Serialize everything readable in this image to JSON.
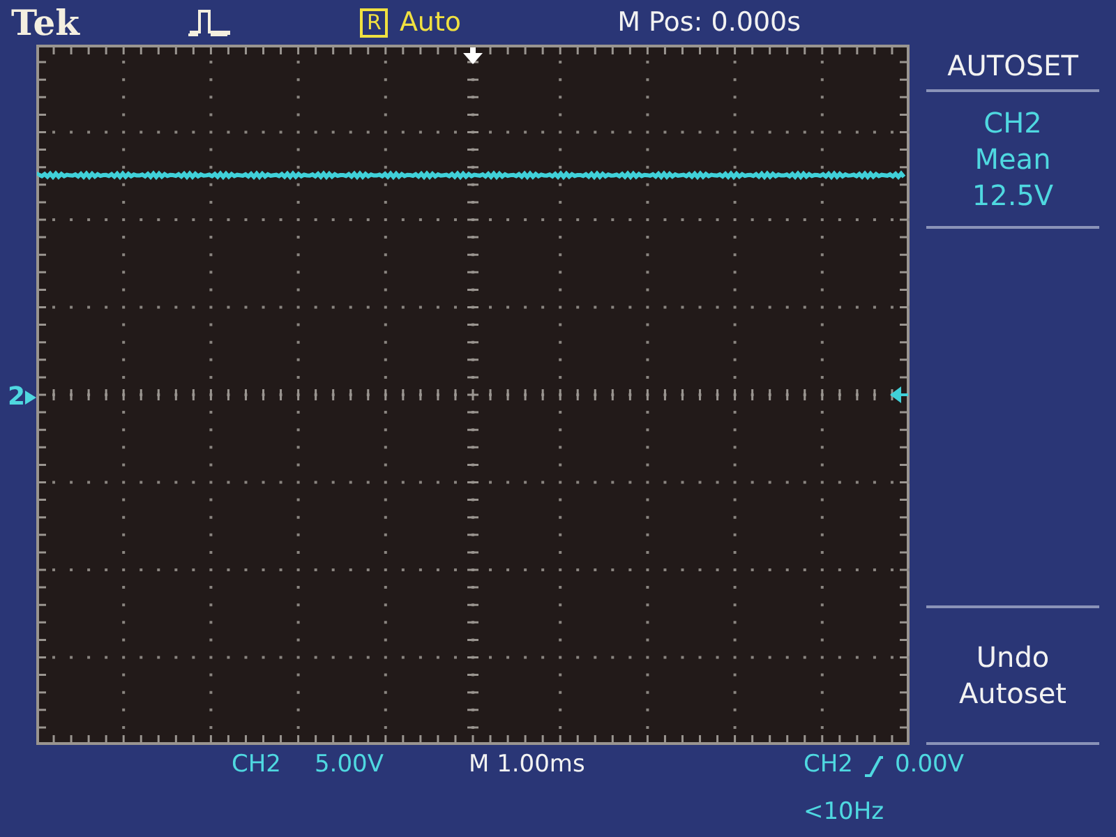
{
  "brand": "Tek",
  "acquisition": {
    "run_state_badge": "R",
    "mode": "Auto"
  },
  "horizontal_position": "M Pos: 0.000s",
  "menu": {
    "title": "AUTOSET",
    "items": [
      {
        "kind": "readout",
        "lines": [
          "CH2",
          "Mean",
          "12.5V"
        ]
      },
      {
        "kind": "empty"
      },
      {
        "kind": "action",
        "lines": [
          "Undo",
          "Autoset"
        ]
      }
    ]
  },
  "channel_marker": "2",
  "status_bar": {
    "channel": "CH2",
    "volts_per_div": "5.00V",
    "timebase": "M 1.00ms",
    "trigger_source": "CH2",
    "trigger_level": "0.00V",
    "trigger_frequency": "<10Hz"
  }
}
